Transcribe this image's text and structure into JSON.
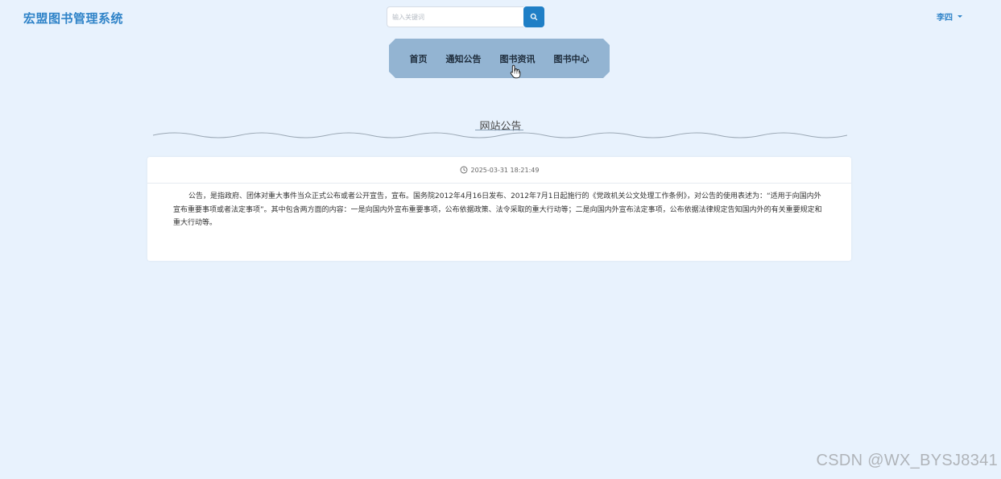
{
  "header": {
    "logo": "宏盟图书管理系统",
    "search": {
      "placeholder": "输入关键词",
      "value": ""
    },
    "user": {
      "name": "李四"
    }
  },
  "nav": {
    "items": [
      "首页",
      "通知公告",
      "图书资讯",
      "图书中心"
    ]
  },
  "section": {
    "title": "网站公告"
  },
  "notice": {
    "timestamp": "2025-03-31 18:21:49",
    "content": "公告，是指政府、团体对重大事件当众正式公布或者公开宣告，宣布。国务院2012年4月16日发布、2012年7月1日起施行的《党政机关公文处理工作条例》，对公告的使用表述为：“适用于向国内外宣布重要事项或者法定事项”。其中包含两方面的内容：一是向国内外宣布重要事项，公布依据政策、法令采取的重大行动等；二是向国内外宣布法定事项，公布依据法律规定告知国内外的有关重要规定和重大行动等。"
  },
  "watermark": "CSDN @WX_BYSJ8341",
  "colors": {
    "background": "#e8f2fd",
    "brand": "#2f83c8",
    "search_button": "#1f7fc6",
    "nav_background": "#93b4d2"
  },
  "icons": {
    "search": "search-icon",
    "user_menu": "chevron-down-icon",
    "timestamp": "clock-icon",
    "cursor": "hand-pointer-icon"
  }
}
